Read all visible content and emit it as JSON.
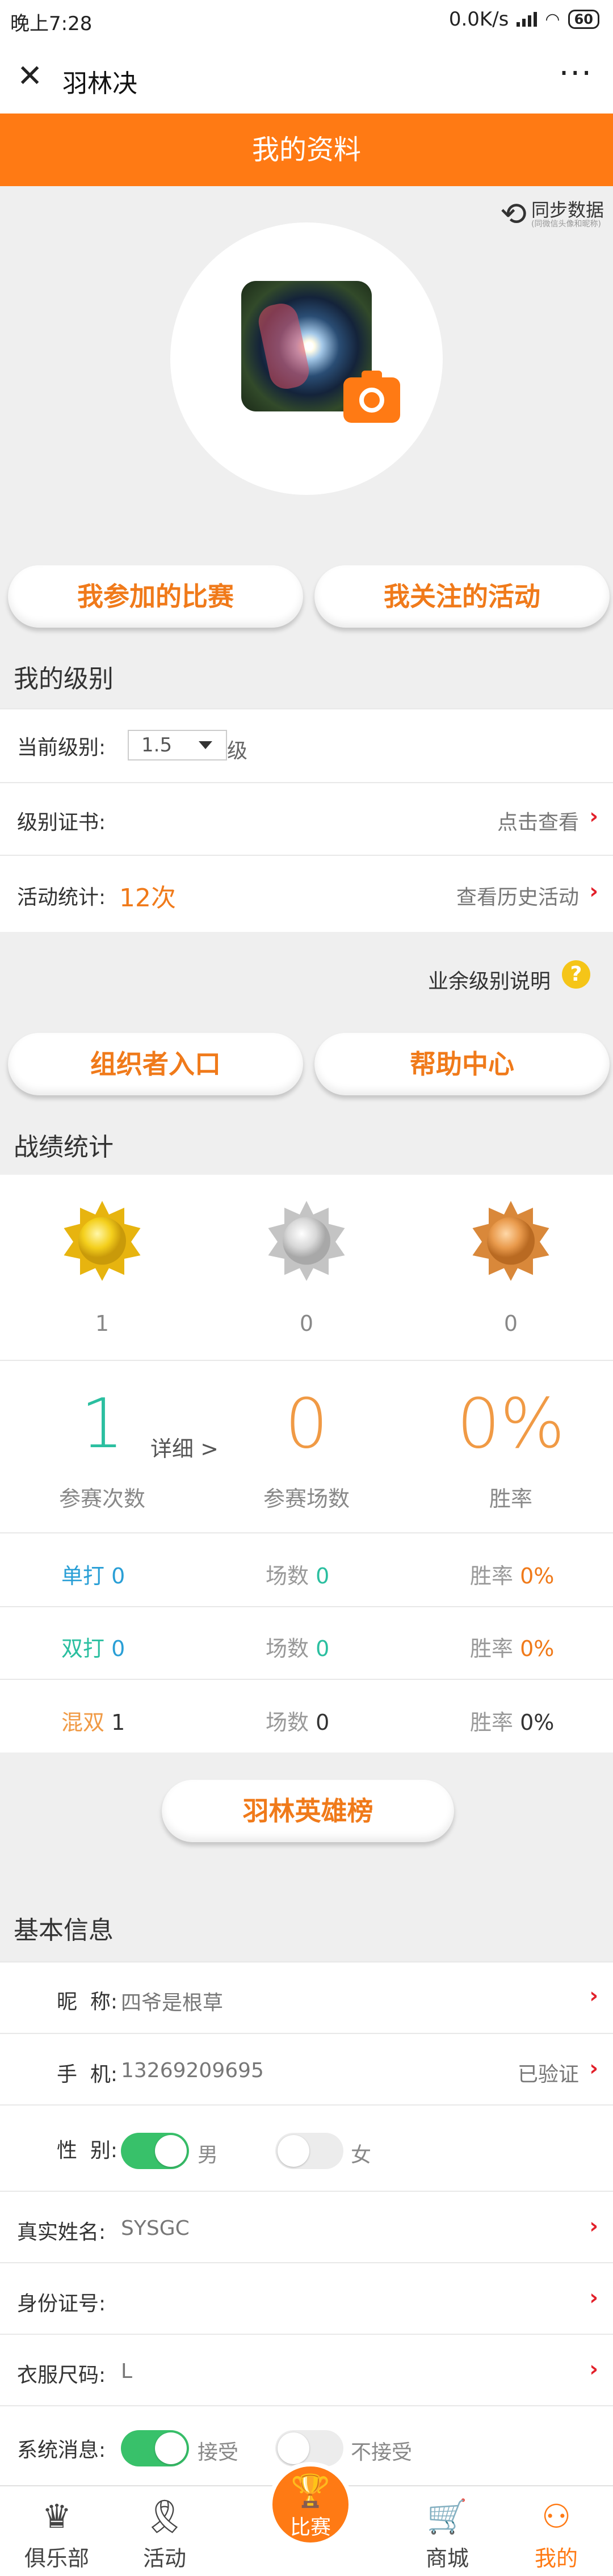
{
  "status_bar": {
    "time": "晚上7:28",
    "speed": "0.0K/s",
    "battery": "60"
  },
  "nav": {
    "title": "羽林决"
  },
  "page_title": "我的资料",
  "sync": {
    "label": "同步数据",
    "sub": "(同微信头像和昵称)"
  },
  "buttons": {
    "my_matches": "我参加的比赛",
    "my_followed": "我关注的活动",
    "organizer": "组织者入口",
    "help": "帮助中心",
    "hero_board": "羽林英雄榜"
  },
  "level": {
    "section_title": "我的级别",
    "current_label": "当前级别:",
    "current_value": "1.5",
    "unit": "级",
    "cert_label": "级别证书:",
    "cert_action": "点击查看",
    "activity_label": "活动统计:",
    "activity_count": "12次",
    "history_action": "查看历史活动",
    "amateur_note": "业余级别说明",
    "help_icon": "?"
  },
  "stats": {
    "section_title": "战绩统计",
    "medals": [
      {
        "name": "gold",
        "count": "1"
      },
      {
        "name": "silver",
        "count": "0"
      },
      {
        "name": "bronze",
        "count": "0"
      }
    ],
    "participations": "1",
    "participations_label": "参赛次数",
    "detail_link": "详细 >",
    "matches": "0",
    "matches_label": "参赛场数",
    "win_rate": "0%",
    "win_rate_label": "胜率",
    "rows": [
      {
        "type": "单打",
        "count": "0",
        "matches_label": "场数",
        "matches": "0",
        "rate_label": "胜率",
        "rate": "0%"
      },
      {
        "type": "双打",
        "count": "0",
        "matches_label": "场数",
        "matches": "0",
        "rate_label": "胜率",
        "rate": "0%"
      },
      {
        "type": "混双",
        "count": "1",
        "matches_label": "场数",
        "matches": "0",
        "rate_label": "胜率",
        "rate": "0%"
      }
    ]
  },
  "basic": {
    "section_title": "基本信息",
    "nickname_label": "昵  称:",
    "nickname": "四爷是根草",
    "phone_label": "手  机:",
    "phone": "13269209695",
    "phone_status": "已验证",
    "gender_label": "性  别:",
    "gender_male": "男",
    "gender_female": "女",
    "realname_label": "真实姓名:",
    "realname": "SYSGC",
    "idcard_label": "身份证号:",
    "idcard": "",
    "size_label": "衣服尺码:",
    "size": "L",
    "sysmsg_label": "系统消息:",
    "accept": "接受",
    "reject": "不接受"
  },
  "tabs": [
    {
      "label": "俱乐部",
      "icon": "crown-icon"
    },
    {
      "label": "活动",
      "icon": "ribbon-icon"
    },
    {
      "label": "比赛",
      "icon": "trophy-icon"
    },
    {
      "label": "商城",
      "icon": "cart-icon"
    },
    {
      "label": "我的",
      "icon": "user-icon"
    }
  ],
  "colors": {
    "accent": "#ff7a14",
    "link_red": "#e2202a",
    "green": "#38c16a",
    "teal": "#2bbfa0",
    "blue": "#2a9fd6"
  }
}
